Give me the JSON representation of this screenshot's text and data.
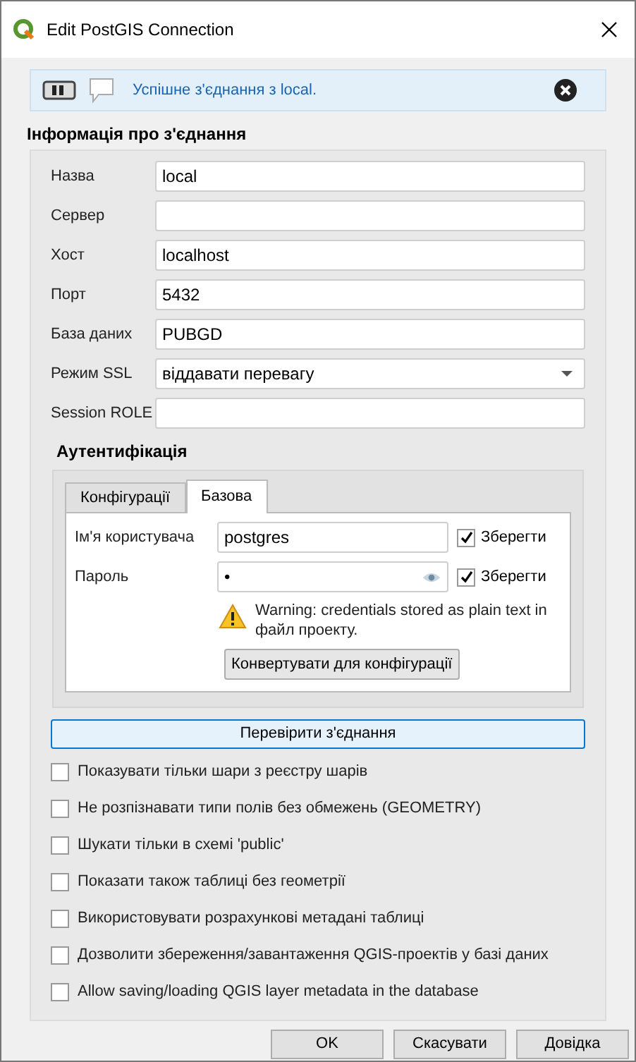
{
  "window": {
    "title": "Edit PostGIS Connection"
  },
  "message": {
    "text": "Успішне з'єднання з local."
  },
  "connection": {
    "title": "Інформація про з'єднання",
    "fields": [
      {
        "kind": "text",
        "label": "Назва",
        "value": "local"
      },
      {
        "kind": "text",
        "label": "Сервер"
      },
      {
        "kind": "text",
        "label": "Хост",
        "value": "localhost"
      },
      {
        "kind": "text",
        "label": "Порт",
        "value": "5432"
      },
      {
        "kind": "text",
        "label": "База даних",
        "value": "PUBGD"
      },
      {
        "kind": "select",
        "label": "Режим SSL",
        "value": "віддавати перевагу"
      },
      {
        "kind": "text",
        "label": "Session ROLE"
      }
    ]
  },
  "auth": {
    "title": "Аутентифікація",
    "tabs": [
      {
        "label": "Конфігурації",
        "selected": false
      },
      {
        "label": "Базова",
        "selected": true
      }
    ],
    "rows": [
      {
        "kind": "text",
        "label": "Ім'я користувача",
        "value": "postgres",
        "store": {
          "label": "Зберегти",
          "checked": true
        }
      },
      {
        "kind": "password",
        "label": "Пароль",
        "value": "•",
        "store": {
          "label": "Зберегти",
          "checked": true
        }
      }
    ],
    "warning": "Warning: credentials stored as plain text in файл проекту.",
    "convert_button": "Конвертувати для конфігурації"
  },
  "test_button": "Перевірити з'єднання",
  "options": [
    {
      "label": "Показувати тільки шари з реєстру шарів",
      "checked": false
    },
    {
      "label": "Не розпізнавати типи полів без обмежень (GEOMETRY)",
      "checked": false
    },
    {
      "label": "Шукати тільки в схемі 'public'",
      "checked": false
    },
    {
      "label": "Показати також таблиці без геометрії",
      "checked": false
    },
    {
      "label": "Використовувати розрахункові метадані таблиці",
      "checked": false
    },
    {
      "label": "Дозволити збереження/завантаження QGIS-проектів у базі даних",
      "checked": false
    },
    {
      "label": "Allow saving/loading QGIS layer metadata in the database",
      "checked": false
    }
  ],
  "buttons": [
    "OK",
    "Скасувати",
    "Довідка"
  ]
}
